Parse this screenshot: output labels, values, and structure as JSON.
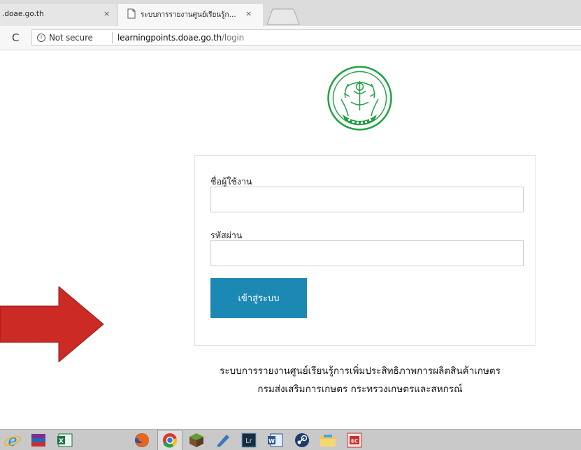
{
  "browser": {
    "tabs": [
      {
        "title": ".doae.go.th",
        "close": "×"
      },
      {
        "title": "ระบบการรายงานศูนย์เรียนรู้ก…",
        "close": "×"
      }
    ],
    "reload_glyph": "C",
    "security_text": "Not secure",
    "url_host": "learningpoints.doae.go.th",
    "url_path": "/login"
  },
  "login": {
    "username_label": "ชื่อผู้ใช้งาน",
    "username_value": "",
    "password_label": "รหัสผ่าน",
    "password_value": "",
    "submit_label": "เข้าสู่ระบบ"
  },
  "footer": {
    "line1": "ระบบการรายงานศูนย์เรียนรู้การเพิ่มประสิทธิภาพการผลิตสินค้าเกษตร",
    "line2": "กรมส่งเสริมการเกษตร กระทรวงเกษตรและสหกรณ์"
  },
  "colors": {
    "accent": "#1c89b4",
    "logo_green": "#22a146",
    "arrow_red": "#cc2a24"
  },
  "taskbar": {
    "icons": [
      "internet-explorer-icon",
      "winrar-icon",
      "excel-icon",
      "firefox-icon",
      "chrome-icon",
      "minecraft-icon",
      "stylus-icon",
      "lightroom-icon",
      "word-icon",
      "steam-icon",
      "file-explorer-icon",
      "acrobat-icon"
    ]
  }
}
